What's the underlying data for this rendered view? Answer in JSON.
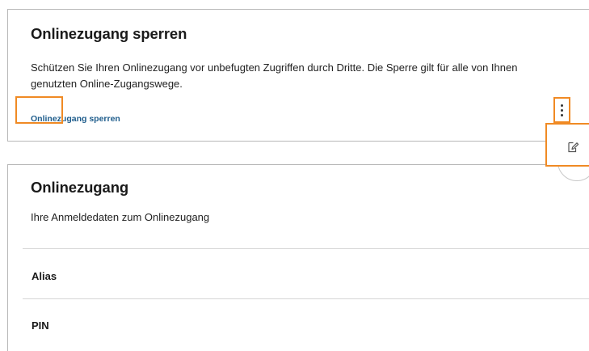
{
  "lock_card": {
    "title": "Onlinezugang sperren",
    "description": "Schützen Sie Ihren Onlinezugang vor unbefugten Zugriffen durch Dritte. Die Sperre gilt für alle von Ihnen genutzten Online-Zugangswege.",
    "link_label": "Onlinezugang sperren"
  },
  "access_card": {
    "title": "Onlinezugang",
    "subtitle": "Ihre Anmeldedaten zum Onlinezugang",
    "rows": [
      {
        "label": "Alias"
      },
      {
        "label": "PIN"
      }
    ],
    "more_menu_icon": "vertical-dots-icon",
    "edit_icon": "pencil-edit-icon"
  },
  "colors": {
    "highlight": "#f08a24",
    "link": "#1f5d8c",
    "card_border": "#b8b8b8",
    "divider": "#d6d6d6"
  }
}
